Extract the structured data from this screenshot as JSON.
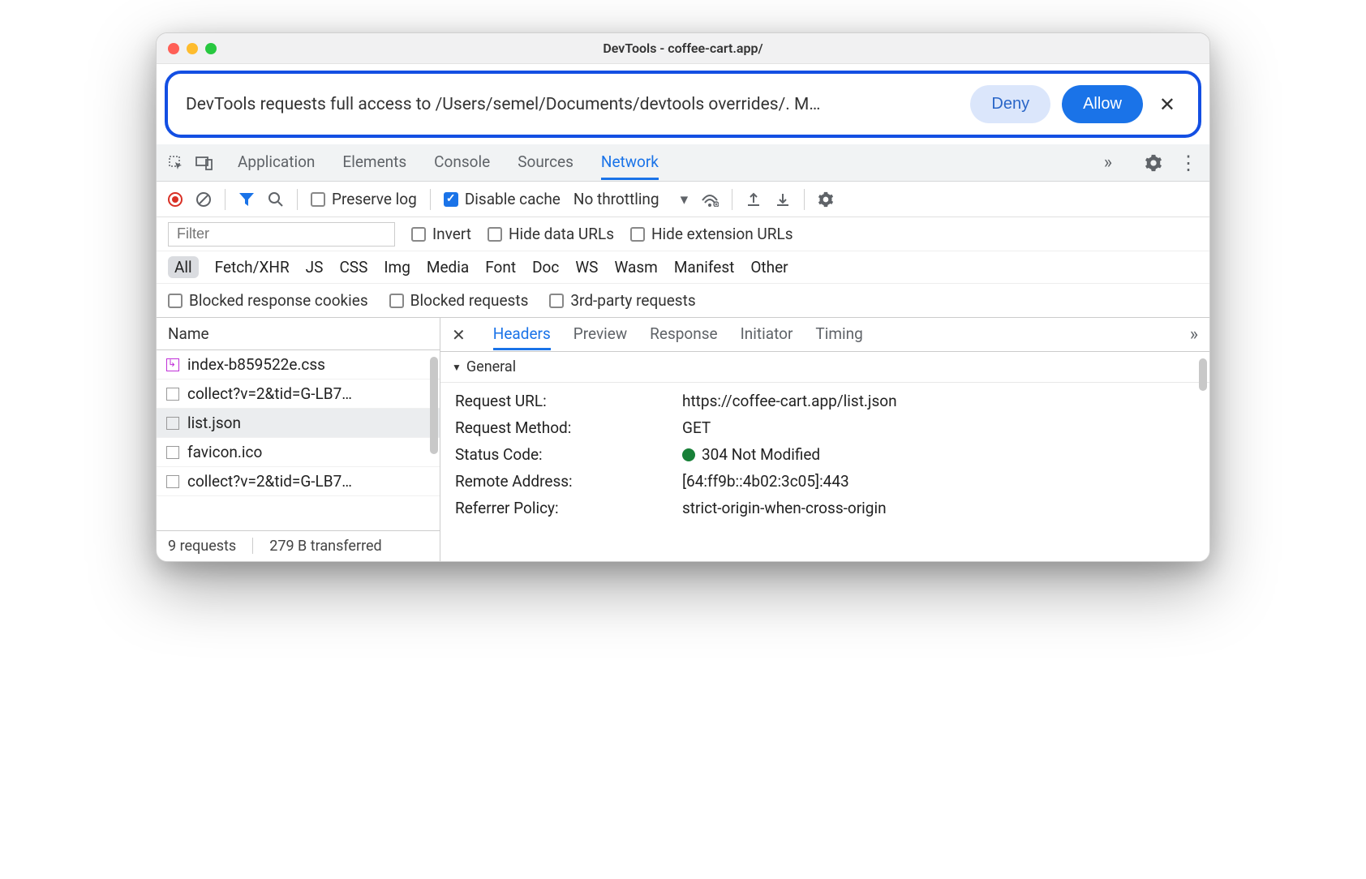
{
  "window": {
    "title": "DevTools - coffee-cart.app/"
  },
  "prompt": {
    "text": "DevTools requests full access to /Users/semel/Documents/devtools overrides/. M…",
    "deny": "Deny",
    "allow": "Allow"
  },
  "mainTabs": {
    "items": [
      "Application",
      "Elements",
      "Console",
      "Sources",
      "Network"
    ],
    "active": "Network"
  },
  "toolbar": {
    "preserve_log": "Preserve log",
    "disable_cache": "Disable cache",
    "throttling": "No throttling"
  },
  "filterRow": {
    "placeholder": "Filter",
    "invert": "Invert",
    "hide_data": "Hide data URLs",
    "hide_ext": "Hide extension URLs"
  },
  "types": [
    "All",
    "Fetch/XHR",
    "JS",
    "CSS",
    "Img",
    "Media",
    "Font",
    "Doc",
    "WS",
    "Wasm",
    "Manifest",
    "Other"
  ],
  "blocked": {
    "cookies": "Blocked response cookies",
    "requests": "Blocked requests",
    "third": "3rd-party requests"
  },
  "requestList": {
    "header": "Name",
    "items": [
      {
        "name": "index-b859522e.css",
        "override": true
      },
      {
        "name": "collect?v=2&tid=G-LB7…",
        "override": false
      },
      {
        "name": "list.json",
        "override": false,
        "selected": true
      },
      {
        "name": "favicon.ico",
        "override": false
      },
      {
        "name": "collect?v=2&tid=G-LB7…",
        "override": false
      }
    ],
    "footer_requests": "9 requests",
    "footer_transferred": "279 B transferred"
  },
  "detailTabs": {
    "items": [
      "Headers",
      "Preview",
      "Response",
      "Initiator",
      "Timing"
    ],
    "active": "Headers"
  },
  "general": {
    "title": "General",
    "rows": [
      {
        "k": "Request URL:",
        "v": "https://coffee-cart.app/list.json"
      },
      {
        "k": "Request Method:",
        "v": "GET"
      },
      {
        "k": "Status Code:",
        "v": "304 Not Modified",
        "status": true
      },
      {
        "k": "Remote Address:",
        "v": "[64:ff9b::4b02:3c05]:443"
      },
      {
        "k": "Referrer Policy:",
        "v": "strict-origin-when-cross-origin"
      }
    ]
  }
}
